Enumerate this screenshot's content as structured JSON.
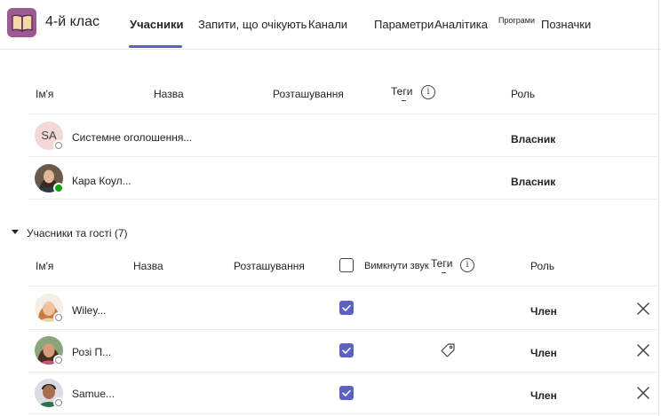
{
  "team": {
    "name": "4-й клас"
  },
  "tabs": [
    {
      "label": "Учасники",
      "active": true
    },
    {
      "label": "Запити, що очікують"
    },
    {
      "label": "Канали"
    },
    {
      "label": "Параметри"
    },
    {
      "label": "Аналітика"
    },
    {
      "label": "Програми"
    },
    {
      "label": "Позначки"
    }
  ],
  "owners": {
    "columns": {
      "name": "Ім'я",
      "title": "Назва",
      "location": "Розташування",
      "tags": "Теги",
      "role": "Роль"
    },
    "rows": [
      {
        "initials": "SA",
        "name": "Системне оголошення...",
        "role": "Власник",
        "presence": "offline"
      },
      {
        "name": "Кара Коул...",
        "role": "Власник",
        "presence": "available"
      }
    ]
  },
  "members": {
    "section_title": "Учасники та гості (7)",
    "columns": {
      "name": "Ім'я",
      "title": "Назва",
      "location": "Розташування",
      "mute": "Вимкнути звук",
      "tags": "Теги",
      "role": "Роль"
    },
    "rows": [
      {
        "name": "Wiley...",
        "role": "Член",
        "muted": true,
        "presence": "offline"
      },
      {
        "name": "Розі П...",
        "role": "Член",
        "muted": true,
        "presence": "offline",
        "has_tag_icon": true
      },
      {
        "name": "Samue...",
        "role": "Член",
        "muted": true,
        "presence": "offline"
      }
    ]
  },
  "colors": {
    "accent": "#5b5fc7",
    "logo": "#9b5a93",
    "available": "#13a10e"
  },
  "icons": {
    "info": "info-icon",
    "tag": "tag-icon",
    "remove": "close-icon",
    "caret": "caret-down-icon",
    "logo": "book-icon"
  }
}
